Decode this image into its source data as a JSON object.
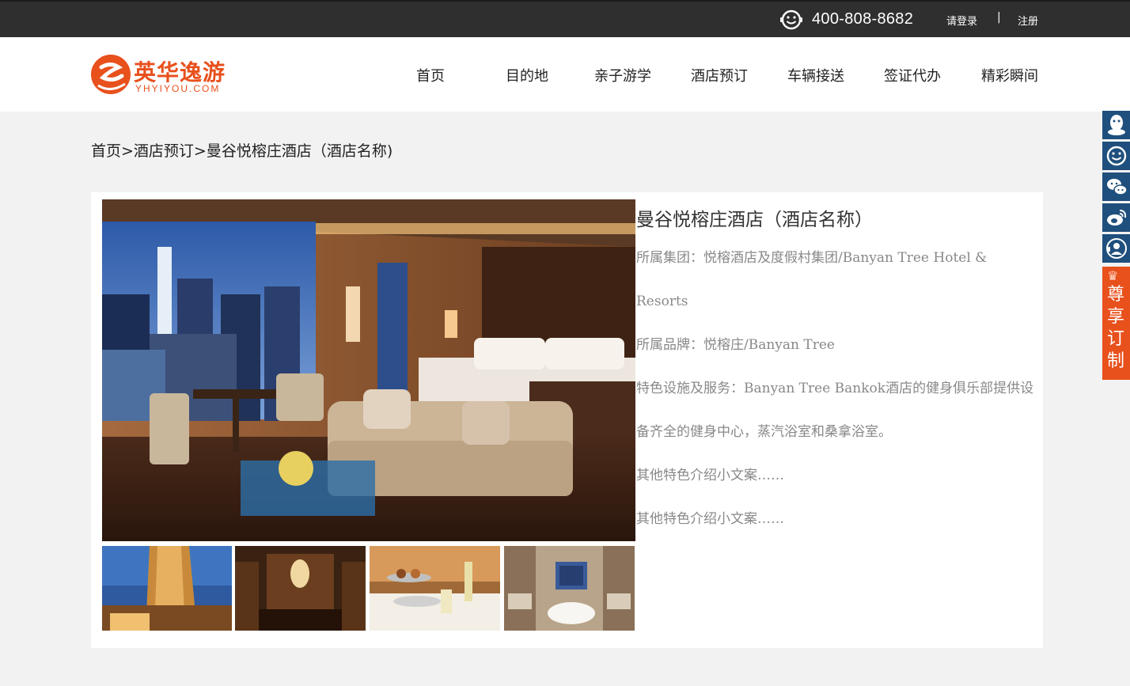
{
  "topbar": {
    "icon": "smile-icon",
    "phone": "400-808-8682",
    "login": "请登录",
    "separator": "|",
    "register": "注册"
  },
  "logo": {
    "cn": "英华逸游",
    "en": "YHYIYOU.COM"
  },
  "nav": [
    {
      "label": "首页"
    },
    {
      "label": "目的地"
    },
    {
      "label": "亲子游学"
    },
    {
      "label": "酒店预订"
    },
    {
      "label": "车辆接送"
    },
    {
      "label": "签证代办"
    },
    {
      "label": "精彩瞬间"
    }
  ],
  "sidebar": {
    "icons": [
      "qq-icon",
      "smile-icon",
      "wechat-icon",
      "weibo-icon",
      "customer-service-icon"
    ],
    "vip_label": "尊享订制",
    "vip_chars": [
      "尊",
      "享",
      "订",
      "制"
    ]
  },
  "breadcrumb": "首页>酒店预订>曼谷悦榕庄酒店（酒店名称)",
  "hotel": {
    "name": "曼谷悦榕庄酒店（酒店名称）",
    "group": "所属集团：悦榕酒店及度假村集团/Banyan Tree Hotel & Resorts",
    "brand": "所属品牌：悦榕庄/Banyan Tree",
    "facilities": "特色设施及服务：Banyan Tree Bankok酒店的健身俱乐部提供设备齐全的健身中心，蒸汽浴室和桑拿浴室。",
    "other1": "其他特色介绍小文案……",
    "other2": "其他特色介绍小文案……"
  },
  "colors": {
    "topbar": "#2f2f2f",
    "brand_orange": "#e8501c",
    "sidebar_blue": "#1f4f7d",
    "page_bg": "#f2f2f2"
  }
}
